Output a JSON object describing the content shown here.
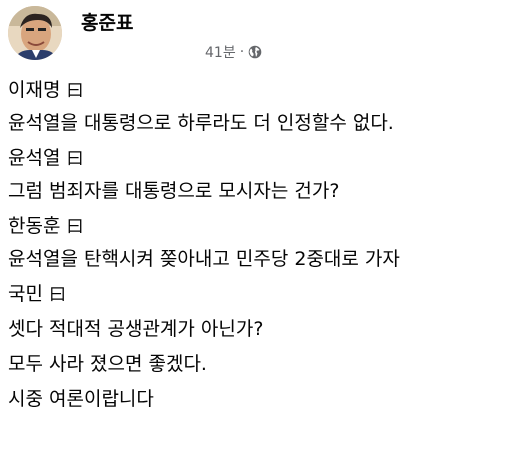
{
  "post": {
    "author": "홍준표",
    "timestamp": "41분",
    "separator": "·",
    "privacy_icon": "globe-icon"
  },
  "body": [
    {
      "type": "speaker",
      "name": "이재명",
      "mark": "曰"
    },
    {
      "type": "text",
      "text": "윤석열을 대통령으로 하루라도 더 인정할수 없다."
    },
    {
      "type": "speaker",
      "name": "윤석열",
      "mark": "曰"
    },
    {
      "type": "text",
      "text": "그럼 범죄자를 대통령으로 모시자는 건가?"
    },
    {
      "type": "speaker",
      "name": "한동훈",
      "mark": "曰"
    },
    {
      "type": "text",
      "text": "윤석열을 탄핵시켜 쫒아내고 민주당 2중대로 가자"
    },
    {
      "type": "speaker",
      "name": "국민",
      "mark": "曰"
    },
    {
      "type": "text",
      "text": "셋다 적대적 공생관계가 아닌가?"
    },
    {
      "type": "text",
      "text": "모두 사라 졌으면 좋겠다."
    },
    {
      "type": "text",
      "text": "시중 여론이랍니다"
    }
  ],
  "colors": {
    "text": "#050505",
    "meta": "#65676b"
  }
}
